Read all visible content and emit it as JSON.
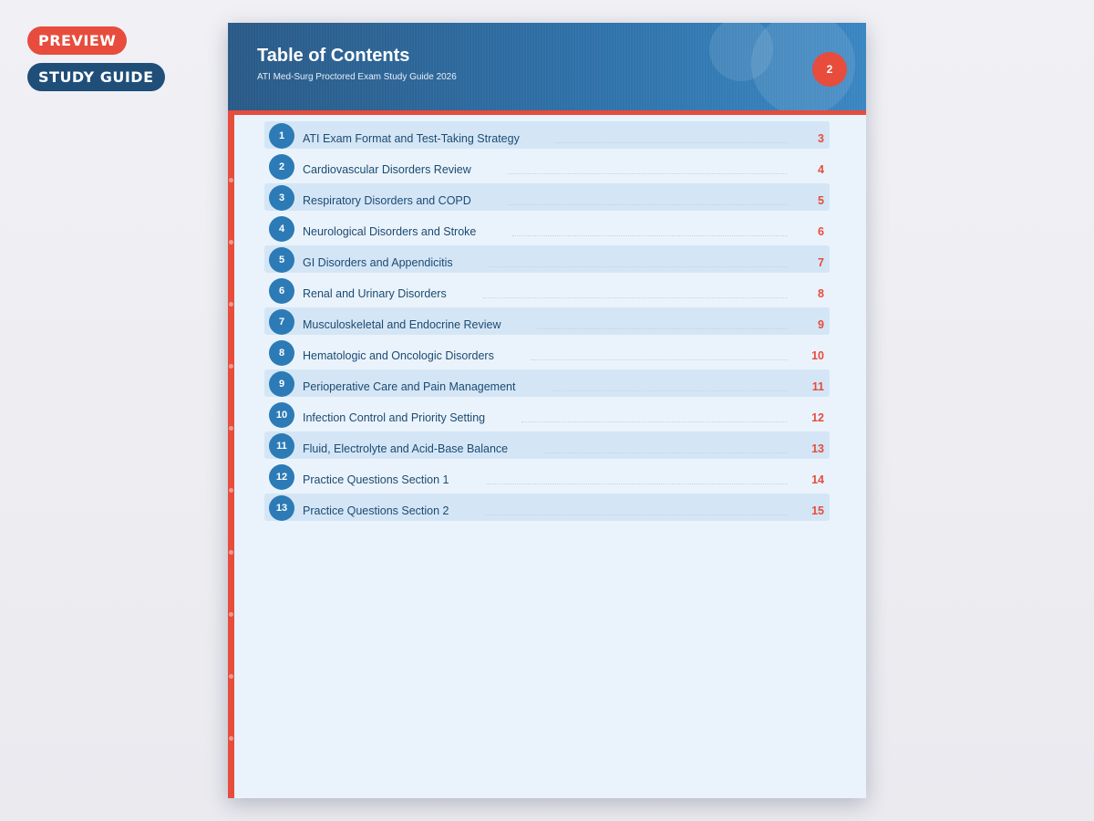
{
  "badges": {
    "preview": "PREVIEW",
    "study_guide": "STUDY GUIDE"
  },
  "header": {
    "title": "Table of Contents",
    "subtitle": "ATI Med-Surg Proctored Exam Study Guide 2026",
    "page_number": "2"
  },
  "colors": {
    "accent_red": "#e74c3c",
    "header_blue": "#2c6aa3",
    "number_circle_blue": "#2c7bb6",
    "row_shade": "#d4e6f6",
    "page_background": "#eaf3fb"
  },
  "toc": [
    {
      "num": "1",
      "title": "ATI Exam Format and Test-Taking Strategy",
      "page": "3"
    },
    {
      "num": "2",
      "title": "Cardiovascular Disorders Review",
      "page": "4"
    },
    {
      "num": "3",
      "title": "Respiratory Disorders and COPD",
      "page": "5"
    },
    {
      "num": "4",
      "title": "Neurological Disorders and Stroke",
      "page": "6"
    },
    {
      "num": "5",
      "title": "GI Disorders and Appendicitis",
      "page": "7"
    },
    {
      "num": "6",
      "title": "Renal and Urinary Disorders",
      "page": "8"
    },
    {
      "num": "7",
      "title": "Musculoskeletal and Endocrine Review",
      "page": "9"
    },
    {
      "num": "8",
      "title": "Hematologic and Oncologic Disorders",
      "page": "10"
    },
    {
      "num": "9",
      "title": "Perioperative Care and Pain Management",
      "page": "11"
    },
    {
      "num": "10",
      "title": "Infection Control and Priority Setting",
      "page": "12"
    },
    {
      "num": "11",
      "title": "Fluid, Electrolyte and Acid-Base Balance",
      "page": "13"
    },
    {
      "num": "12",
      "title": "Practice Questions Section 1",
      "page": "14"
    },
    {
      "num": "13",
      "title": "Practice Questions Section 2",
      "page": "15"
    }
  ]
}
